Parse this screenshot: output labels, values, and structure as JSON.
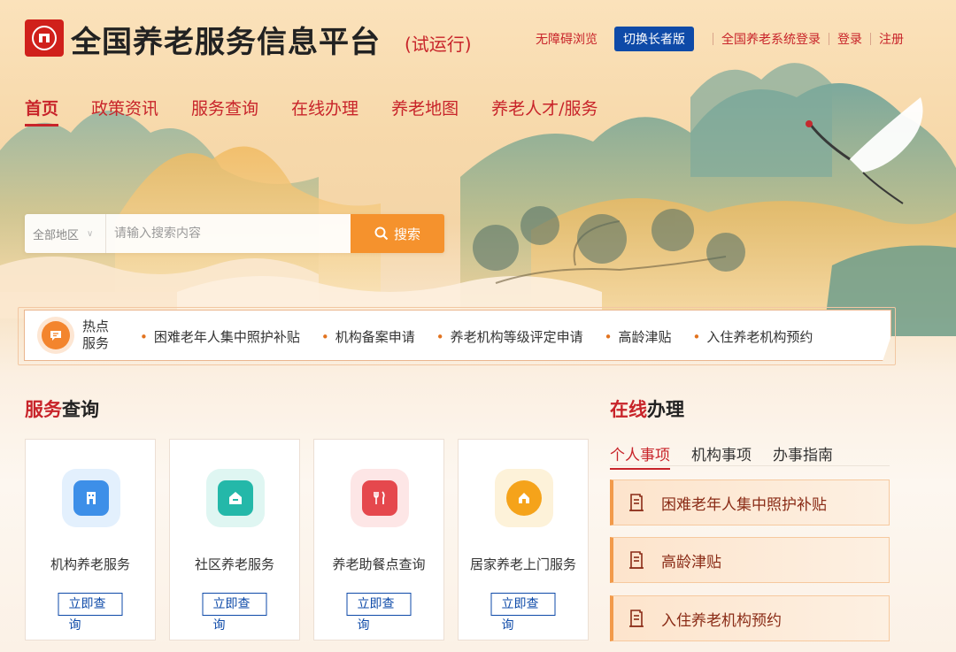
{
  "header": {
    "title": "全国养老服务信息平台",
    "subtitle": "(试运行)",
    "links": {
      "accessibility": "无障碍浏览",
      "elder_mode": "切换长者版",
      "system_login": "全国养老系统登录",
      "login": "登录",
      "register": "注册"
    }
  },
  "nav": {
    "items": [
      {
        "label": "首页",
        "active": true
      },
      {
        "label": "政策资讯"
      },
      {
        "label": "服务查询"
      },
      {
        "label": "在线办理"
      },
      {
        "label": "养老地图"
      },
      {
        "label": "养老人才/服务"
      }
    ]
  },
  "search": {
    "region": "全部地区",
    "placeholder": "请输入搜索内容",
    "button": "搜索"
  },
  "hot": {
    "label_line1": "热点",
    "label_line2": "服务",
    "items": [
      "困难老年人集中照护补贴",
      "机构备案申请",
      "养老机构等级评定申请",
      "高龄津贴",
      "入住养老机构预约"
    ]
  },
  "service_query": {
    "title_hl": "服务",
    "title_rest": "查询",
    "cards": [
      {
        "label": "机构养老服务",
        "button": "立即查询",
        "icon": "building-icon",
        "color": "#3d8fe8"
      },
      {
        "label": "社区养老服务",
        "button": "立即查询",
        "icon": "community-icon",
        "color": "#24b8a9"
      },
      {
        "label": "养老助餐点查询",
        "button": "立即查询",
        "icon": "meal-icon",
        "color": "#e5484d"
      },
      {
        "label": "居家养老上门服务",
        "button": "立即查询",
        "icon": "home-icon",
        "color": "#f5a31a"
      }
    ]
  },
  "online": {
    "title_hl": "在线",
    "title_rest": "办理",
    "tabs": [
      {
        "label": "个人事项",
        "active": true
      },
      {
        "label": "机构事项"
      },
      {
        "label": "办事指南"
      }
    ],
    "items": [
      {
        "label": "困难老年人集中照护补贴"
      },
      {
        "label": "高龄津贴"
      },
      {
        "label": "入住养老机构预约"
      }
    ]
  }
}
